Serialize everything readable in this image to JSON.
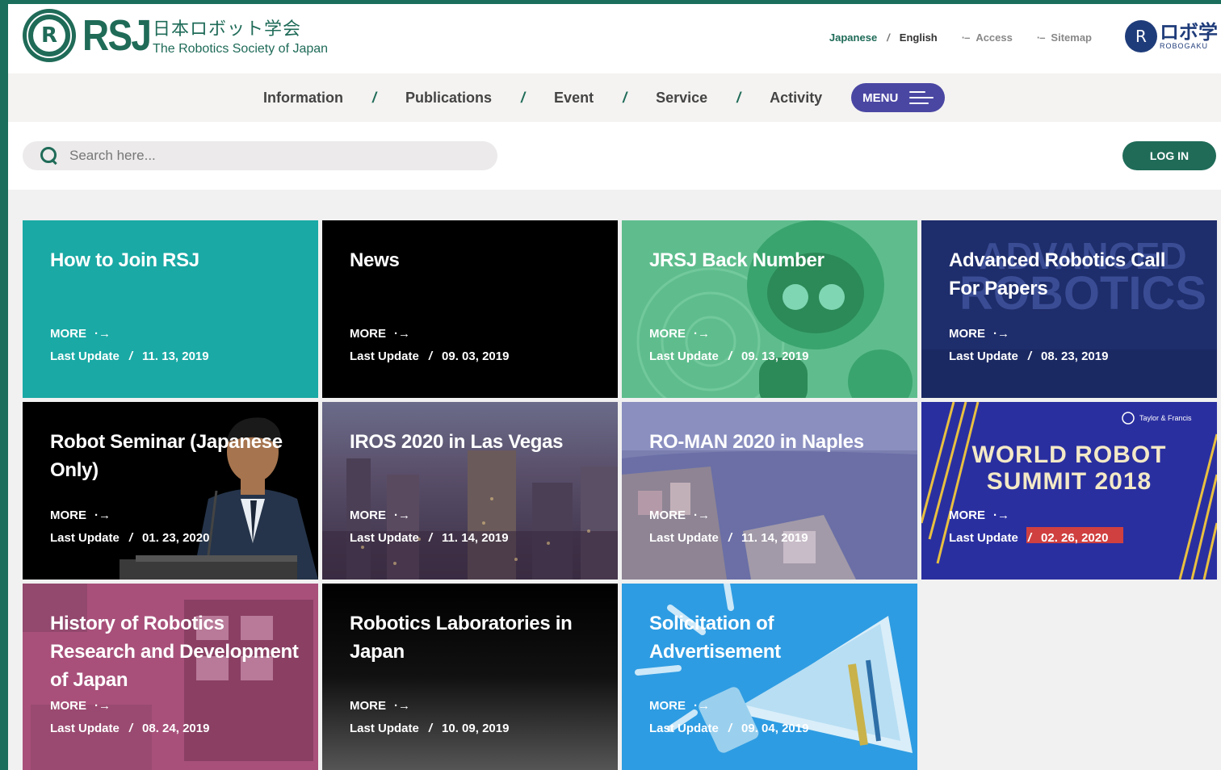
{
  "header": {
    "logo_seal": "R",
    "logo_abbr": "RSJ",
    "logo_jp": "日本ロボット学会",
    "logo_en": "The Robotics Society of Japan",
    "lang_japanese": "Japanese",
    "lang_sep": "/",
    "lang_english": "English",
    "access": "Access",
    "sitemap": "Sitemap",
    "robo_seal": "R",
    "robo_jp": "ロボ学",
    "robo_en": "ROBOGAKU"
  },
  "nav": {
    "items": [
      "Information",
      "Publications",
      "Event",
      "Service",
      "Activity"
    ],
    "sep": "/",
    "menu": "MENU"
  },
  "search": {
    "placeholder": "Search here..."
  },
  "login": "LOG IN",
  "card_more": "MORE",
  "card_update_label": "Last Update",
  "cards": [
    {
      "title": "How to Join RSJ",
      "date": "11. 13, 2019"
    },
    {
      "title": "News",
      "date": "09. 03, 2019"
    },
    {
      "title": "JRSJ Back Number",
      "date": "09. 13, 2019"
    },
    {
      "title": "Advanced Robotics Call For Papers",
      "date": "08. 23, 2019"
    },
    {
      "title": "Robot Seminar (Japanese Only)",
      "date": "01. 23, 2020"
    },
    {
      "title": "IROS 2020 in Las Vegas",
      "date": "11. 14, 2019"
    },
    {
      "title": "RO-MAN 2020 in Naples",
      "date": "11. 14, 2019"
    },
    {
      "title": "",
      "date": "02. 26, 2020"
    },
    {
      "title": "History of Robotics Research and Development of Japan",
      "date": "08. 24, 2019"
    },
    {
      "title": "Robotics Laboratories in Japan",
      "date": "10. 09, 2019"
    },
    {
      "title": "Solicitation of Advertisement",
      "date": "09. 04, 2019"
    }
  ],
  "wrs_banner": {
    "brand": "Taylor & Francis",
    "line1": "WORLD ROBOT",
    "line2": "SUMMIT 2018"
  },
  "adv_bg_text": {
    "line1": "ADVANCED",
    "line2": "ROBOTICS"
  },
  "colors": {
    "brand_green": "#1f6b58",
    "menu_purple": "#4a47a3",
    "teal_card": "#1aa9a5"
  }
}
